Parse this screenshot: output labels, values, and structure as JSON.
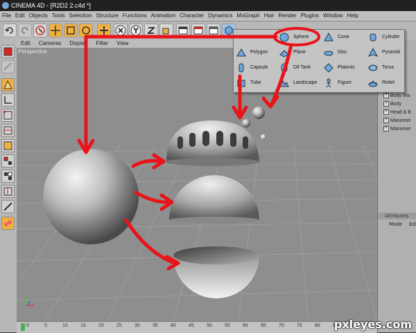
{
  "window": {
    "title": "CINEMA 4D - [R2D2 2.c4d *]"
  },
  "menubar": [
    "File",
    "Edit",
    "Objects",
    "Tools",
    "Selection",
    "Structure",
    "Functions",
    "Animation",
    "Character",
    "Dynamics",
    "MoGraph",
    "Hair",
    "Render",
    "Plugins",
    "Window",
    "Help"
  ],
  "viewport_menu": [
    "Edit",
    "Cameras",
    "Display",
    "Filter",
    "View"
  ],
  "viewport": {
    "label": "Perspective"
  },
  "primitives_popup": {
    "items": [
      {
        "label": "Sphere",
        "icon": "sphere-icon"
      },
      {
        "label": "Cone",
        "icon": "cone-icon"
      },
      {
        "label": "Cylinder",
        "icon": "cylinder-icon"
      },
      {
        "label": "Polygon",
        "icon": "polygon-icon"
      },
      {
        "label": "Plane",
        "icon": "plane-icon"
      },
      {
        "label": "Disc",
        "icon": "disc-icon"
      },
      {
        "label": "Pyramid",
        "icon": "pyramid-icon"
      },
      {
        "label": "Capsule",
        "icon": "capsule-icon"
      },
      {
        "label": "Oil Tank",
        "icon": "oil-tank-icon"
      },
      {
        "label": "Platonic",
        "icon": "platonic-icon"
      },
      {
        "label": "Torus",
        "icon": "torus-icon"
      },
      {
        "label": "Tube",
        "icon": "tube-icon"
      },
      {
        "label": "Landscape",
        "icon": "landscape-icon"
      },
      {
        "label": "Figure",
        "icon": "figure-icon"
      },
      {
        "label": "Relief",
        "icon": "relief-icon"
      }
    ]
  },
  "object_manager": {
    "items": [
      "Body Wa",
      "Body",
      "Head & B",
      "Manomet",
      "Manomet"
    ]
  },
  "attributes": {
    "title": "Attributes",
    "mode": "Mode",
    "edit": "Edit"
  },
  "timeline": {
    "ticks": [
      "0",
      "5",
      "10",
      "15",
      "20",
      "25",
      "30",
      "35",
      "40",
      "45",
      "50",
      "55",
      "60",
      "65",
      "70",
      "75",
      "80",
      "85",
      "90"
    ]
  },
  "watermark": "pxleyes.com",
  "colors": {
    "annotation_arrow": "#e8141a",
    "highlight_ring": "#e8141a"
  }
}
